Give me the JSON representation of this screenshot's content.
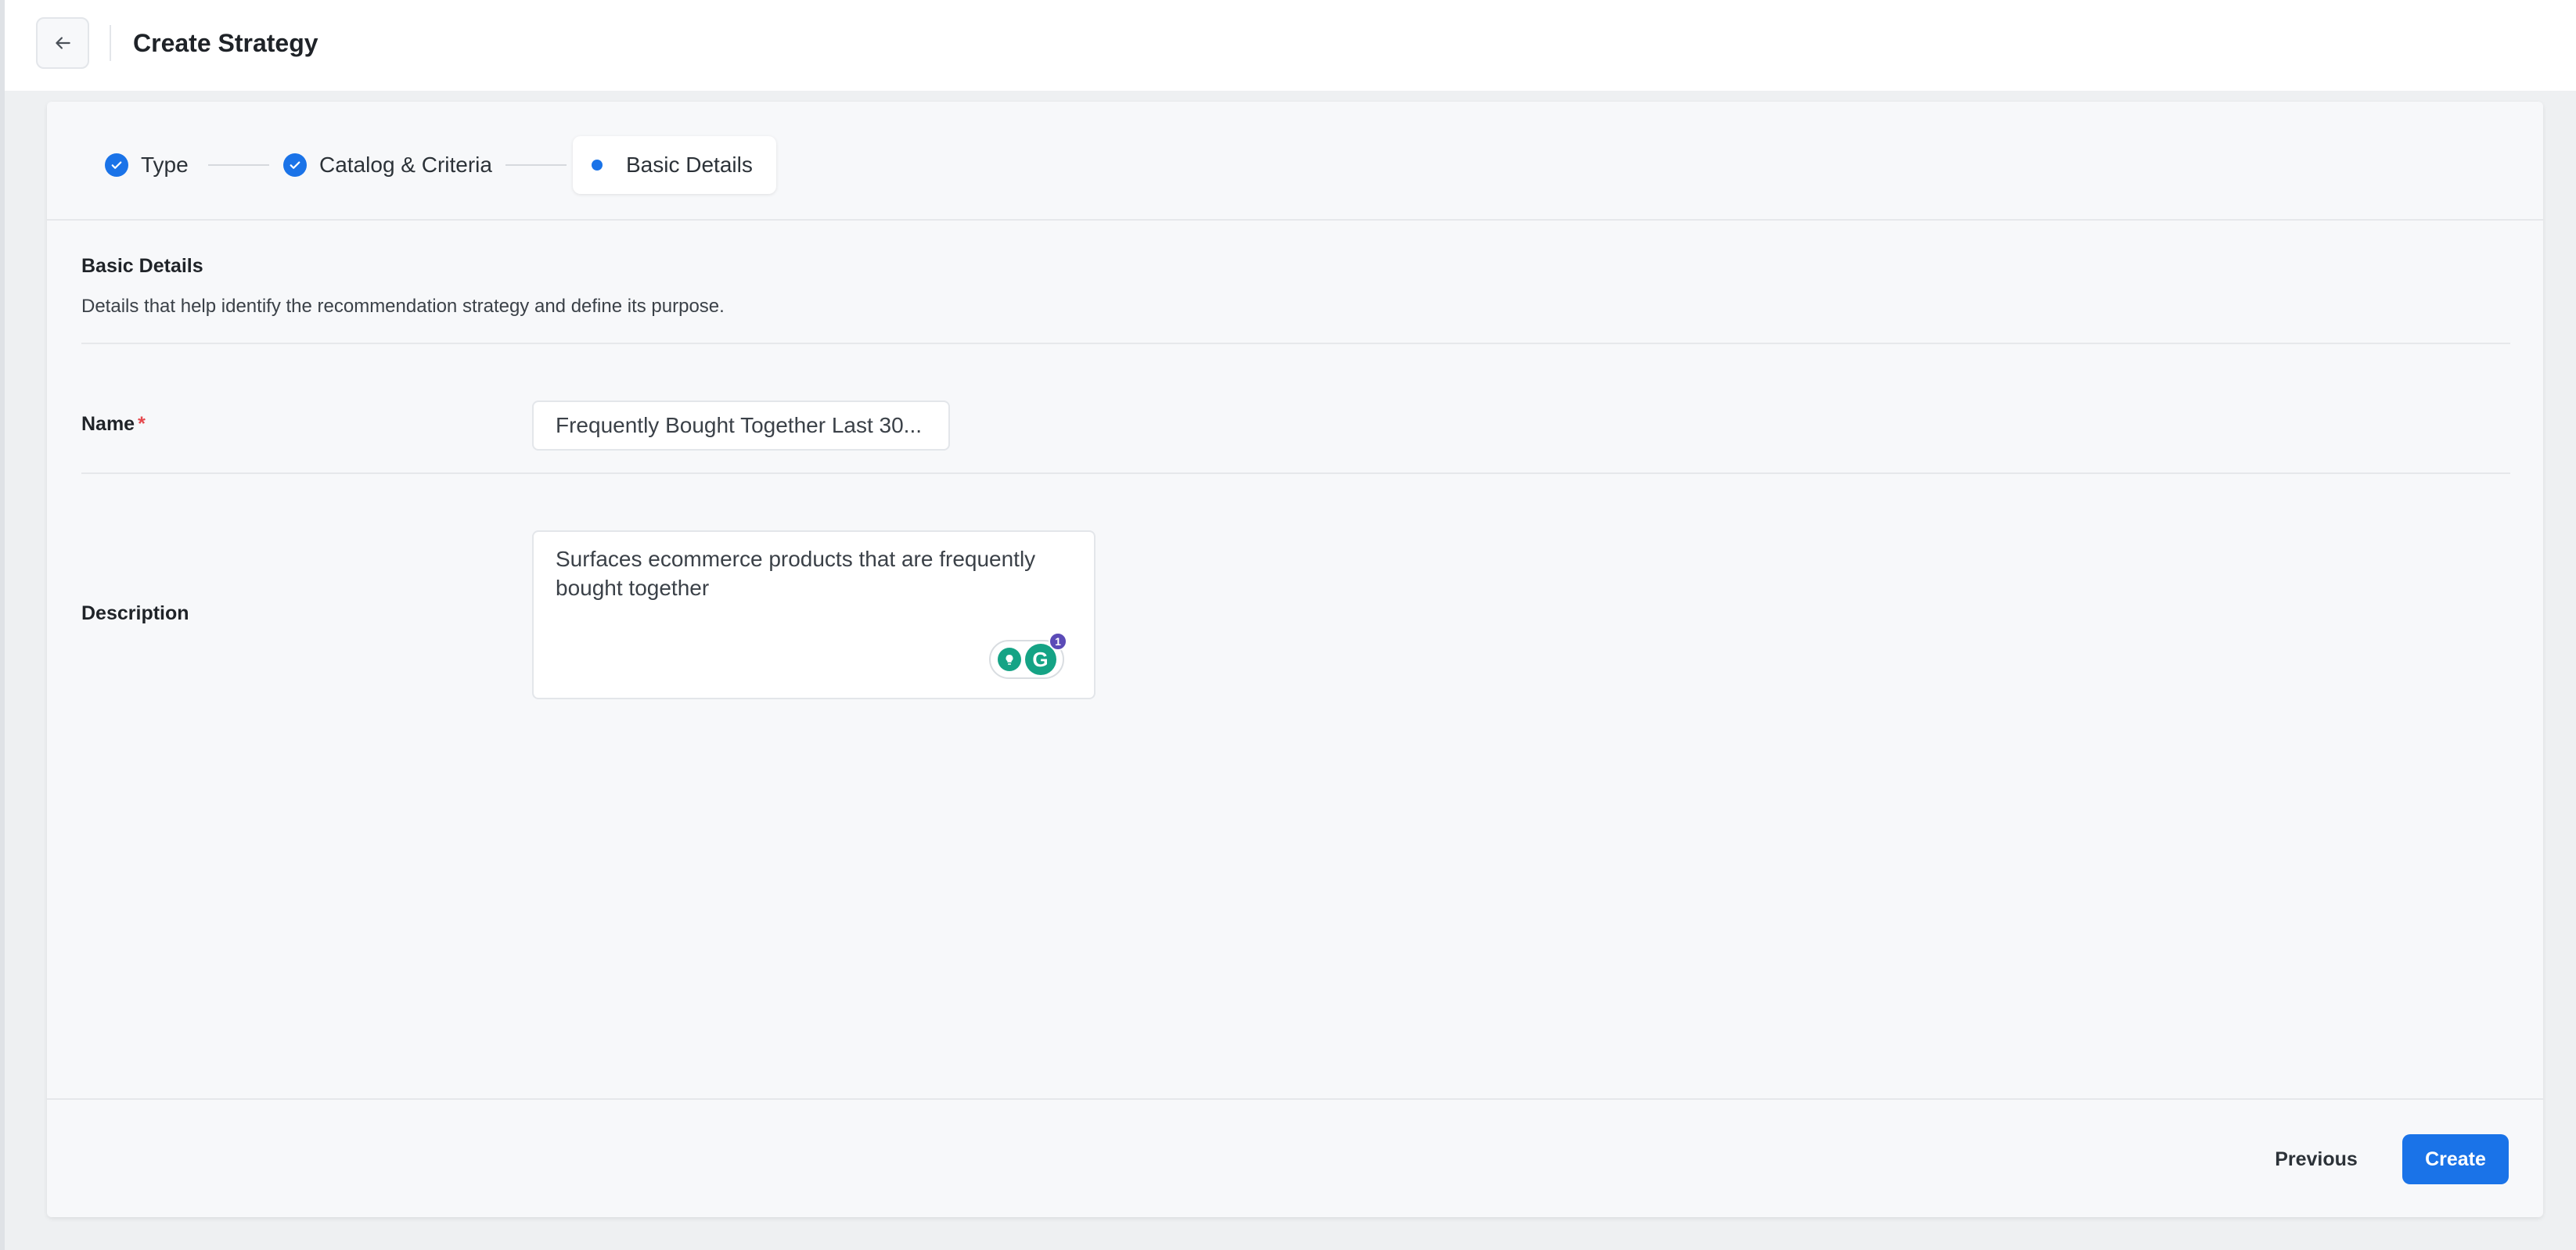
{
  "header": {
    "title": "Create Strategy"
  },
  "stepper": {
    "steps": [
      {
        "label": "Type",
        "status": "completed"
      },
      {
        "label": "Catalog & Criteria",
        "status": "completed"
      },
      {
        "label": "Basic Details",
        "status": "active"
      }
    ]
  },
  "section": {
    "title": "Basic Details",
    "subtitle": "Details that help identify the recommendation strategy and define its purpose."
  },
  "form": {
    "name": {
      "label": "Name",
      "required_mark": "*",
      "value": "Frequently Bought Together Last 30..."
    },
    "description": {
      "label": "Description",
      "value": "Surfaces ecommerce products that are frequently bought together"
    }
  },
  "grammarly": {
    "badge_count": "1"
  },
  "footer": {
    "previous_label": "Previous",
    "create_label": "Create"
  },
  "colors": {
    "primary": "#1a73e8",
    "required": "#e5484d",
    "grammarly": "#15a385"
  }
}
